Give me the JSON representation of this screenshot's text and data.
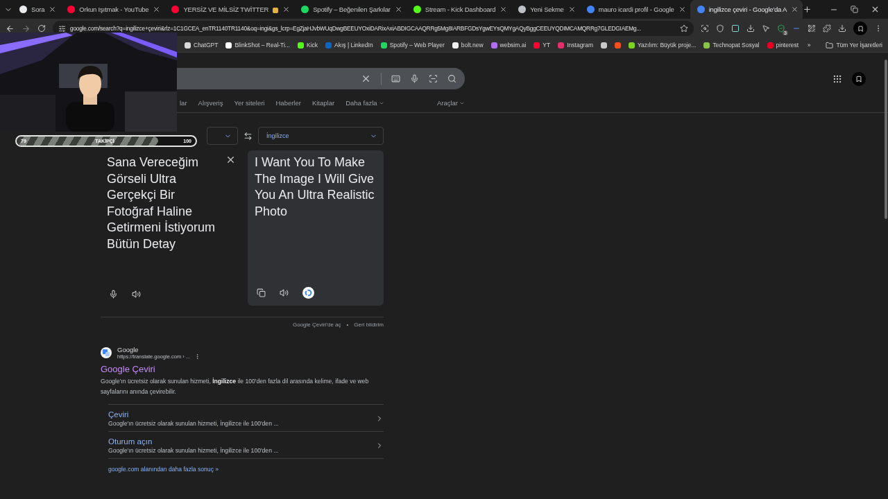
{
  "tabs": [
    {
      "title": "Sora",
      "color": "#e8eaed",
      "selected": false,
      "trailing_icon": false
    },
    {
      "title": "Orkun Işıtmak - YouTube",
      "color": "#ff0033",
      "selected": false,
      "trailing_icon": false
    },
    {
      "title": "YERSİZ VE MİLSİZ TWİTTER",
      "color": "#ff0033",
      "selected": false,
      "trailing_icon": true
    },
    {
      "title": "Spotify – Beğenilen Şarkılar",
      "color": "#1ed760",
      "selected": false,
      "trailing_icon": false
    },
    {
      "title": "Stream - Kick Dashboard",
      "color": "#53fc18",
      "selected": false,
      "trailing_icon": false
    },
    {
      "title": "Yeni Sekme",
      "color": "#bdc1c6",
      "selected": false,
      "trailing_icon": false
    },
    {
      "title": "mauro icardi profil - Google",
      "color": "#4285f4",
      "selected": false,
      "trailing_icon": false
    },
    {
      "title": "ingilizce çeviri - Google'da A",
      "color": "#4285f4",
      "selected": true,
      "trailing_icon": false
    }
  ],
  "toolbar": {
    "url": "google.com/search?q=ingilizce+çeviri&rlz=1C1GCEA_enTR1140TR1140&oq=ingi&gs_lcrp=EgZjaHJvbWUqDwgBEEUYOxiDARixAxiABDIGCAAQRRg5Mg8IARBFGDsYgwEYsQMYgAQyBggCEEUYQDIMCAMQRRg7GLEDGIAEMg...",
    "extension_badge": "3"
  },
  "bookmarks": [
    {
      "label": "ChatGPT",
      "color": "#d9d9d9"
    },
    {
      "label": "BlinkShot – Real-Ti...",
      "color": "#ffffff"
    },
    {
      "label": "Kick",
      "color": "#53fc18"
    },
    {
      "label": "Akış | LinkedIn",
      "color": "#0a66c2"
    },
    {
      "label": "Spotify – Web Player",
      "color": "#1ed760"
    },
    {
      "label": "bolt.new",
      "color": "#f2f2f2"
    },
    {
      "label": "websim.ai",
      "color": "#b06ef0"
    },
    {
      "label": "YT",
      "color": "#ff0033"
    },
    {
      "label": "Instagram",
      "color": "#e1306c"
    },
    {
      "color": "#c9c9c9"
    },
    {
      "color": "#f24e1e"
    },
    {
      "label": "Yazılım: Büyük proje...",
      "color": "#7ed321"
    },
    {
      "label": "Technopat Sosyal",
      "color": "#8bc34a"
    },
    {
      "label": "pinterest",
      "color": "#e60023"
    }
  ],
  "bookmarks_more": "»",
  "all_bookmarks": "Tüm Yer İşaretleri",
  "webcam": {
    "current": "79",
    "label": "TAKİPÇİ",
    "goal": "100",
    "level": 0.79
  },
  "search_nav": {
    "items": [
      {
        "label": "lar",
        "kind": "link"
      },
      {
        "label": "Alışveriş",
        "kind": "link"
      },
      {
        "label": "Yer siteleri",
        "kind": "link"
      },
      {
        "label": "Haberler",
        "kind": "link"
      },
      {
        "label": "Kitaplar",
        "kind": "link"
      },
      {
        "label": "Daha fazla",
        "kind": "menu"
      }
    ],
    "tools": "Araçlar"
  },
  "translate": {
    "target_language": "İngilizce",
    "source_text": "Sana Vereceğim Görseli Ultra Gerçekçi Bir Fotoğraf Haline Getirmeni İstiyorum Bütün Detay",
    "translation": "I Want You To Make The Image I Will Give You An Ultra Realistic Photo",
    "open_link": "Google Çeviri'de aç",
    "separator": "•",
    "feedback": "Geri bildirim"
  },
  "result": {
    "site": "Google",
    "url": "https://translate.google.com › ...",
    "title": "Google Çeviri",
    "snippet": "Google'ın ücretsiz olarak sunulan hizmeti, **İngilizce** ile 100'den fazla dil arasında kelime, ifade ve web sayfalarını anında çevirebilir.",
    "sitelinks": [
      {
        "title": "Çeviri",
        "snippet": "Google'ın ücretsiz olarak sunulan hizmeti, İngilizce ile 100'den ..."
      },
      {
        "title": "Oturum açın",
        "snippet": "Google'ın ücretsiz olarak sunulan hizmeti, İngilizce ile 100'den ..."
      }
    ],
    "more": "google.com alanından daha fazla sonuç »"
  }
}
